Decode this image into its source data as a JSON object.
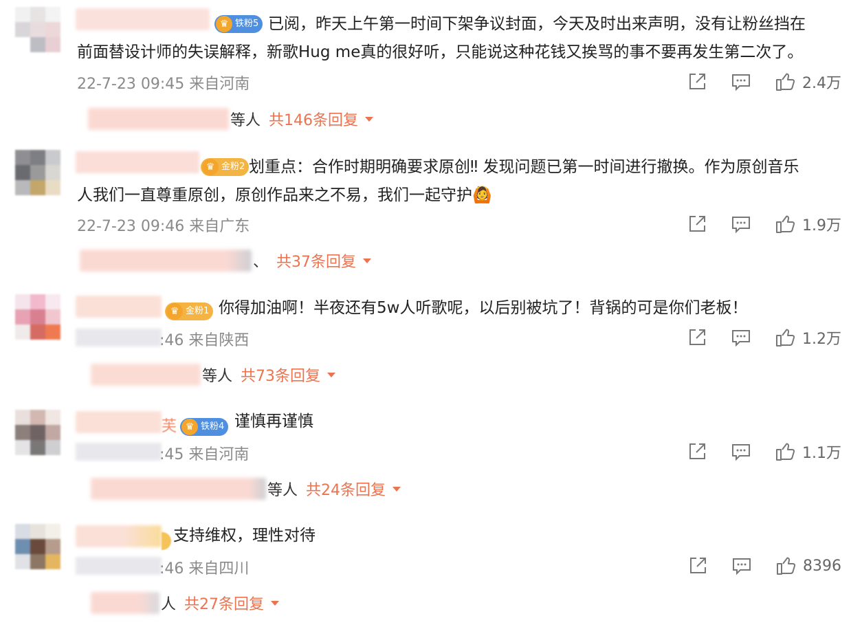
{
  "comments": [
    {
      "badge": "铁粉5",
      "text": [
        "已阅，昨天上午第一时间下架争议封面，今天及时出来声明，没有让粉丝挡在",
        "前面替设计师的失误解释，新歌Hug me真的很好听，只能说这种花钱又挨骂的事不要再发生第二次了。"
      ],
      "meta": "22-7-23 09:45 来自河南",
      "likes": "2.4万",
      "reply_others": "等人",
      "reply_count": "共146条回复"
    },
    {
      "badge": "金粉2",
      "text": [
        "划重点：合作时期明确要求原创‼ 发现问题已第一时间进行撤换。作为原创音乐",
        "人我们一直尊重原创，原创作品来之不易，我们一起守护🙆"
      ],
      "meta": "22-7-23 09:46 来自广东",
      "likes": "1.9万",
      "reply_others": "、",
      "reply_count": "共37条回复"
    },
    {
      "badge": "金粉1",
      "text": [
        "你得加油啊！半夜还有5w人听歌呢，以后别被坑了！背锅的可是你们老板！"
      ],
      "meta": ":46 来自陕西",
      "likes": "1.2万",
      "reply_others": "等人",
      "reply_count": "共73条回复"
    },
    {
      "badge": "铁粉4",
      "stray": "芙",
      "text": [
        "谨慎再谨慎"
      ],
      "meta": ":45 来自河南",
      "likes": "1.1万",
      "reply_others": "等人",
      "reply_count": "共24条回复"
    },
    {
      "badge": "",
      "text": [
        "支持维权，理性对待"
      ],
      "meta": ":46 来自四川",
      "likes": "8396",
      "reply_others": "人",
      "reply_count": "共27条回复"
    }
  ],
  "icons": {
    "share": "share-icon",
    "comment": "comment-icon",
    "like": "like-icon",
    "expand": "chevron-down-icon"
  },
  "colors": {
    "accent": "#eb7350",
    "meta": "#8a8a8a",
    "tiefen_badge": "#4f8fdf",
    "jinfen_badge": "#f3b444"
  }
}
